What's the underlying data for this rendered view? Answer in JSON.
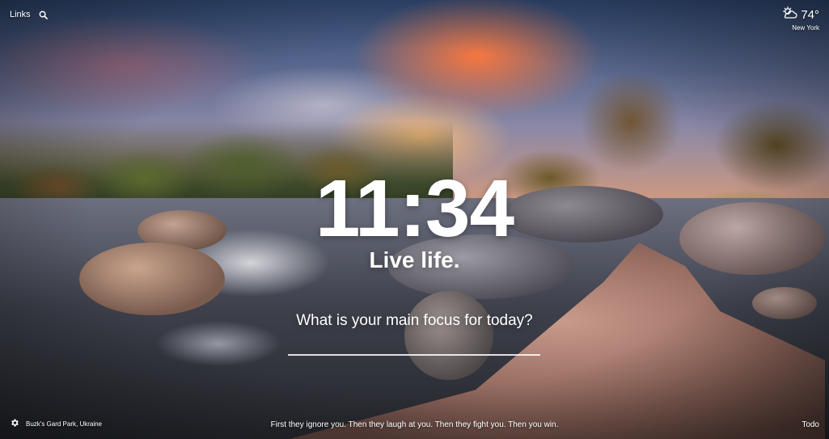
{
  "top_left": {
    "links_label": "Links",
    "search_icon": "search-icon"
  },
  "weather": {
    "temperature": "74°",
    "location": "New York",
    "icon": "partly-cloudy-icon"
  },
  "clock": {
    "time": "11:34"
  },
  "mantra": "Live life.",
  "focus": {
    "prompt": "What is your main focus for today?",
    "value": ""
  },
  "footer": {
    "photo_location": "Buzk's Gard Park, Ukraine",
    "settings_icon": "gear-icon",
    "quote": "First they ignore you. Then they laugh at you. Then they fight you. Then you win.",
    "todo_label": "Todo"
  }
}
